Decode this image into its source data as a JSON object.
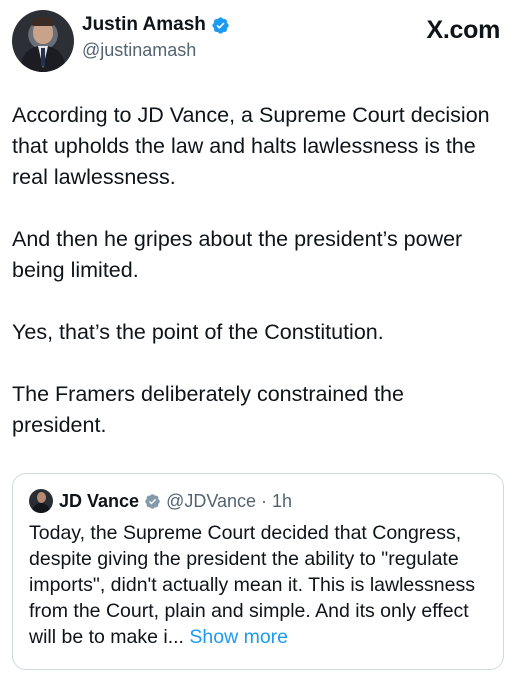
{
  "author": {
    "name": "Justin Amash",
    "handle": "@justinamash"
  },
  "brand": "X.com",
  "post": {
    "paragraphs": [
      "According to JD Vance, a Supreme Court decision that upholds the law and halts lawlessness is the real lawlessness.",
      "And then he gripes about the president’s power being limited.",
      "Yes, that’s the point of the Constitution.",
      "The Framers deliberately constrained the president."
    ]
  },
  "quoted": {
    "name": "JD Vance",
    "handle_time": "@JDVance · 1h",
    "text": "Today, the Supreme Court decided that Congress, despite giving the president the ability to \"regulate imports\", didn't actually mean it. This is lawlessness from the Court, plain and simple. And its only effect will be to make i...",
    "show_more": " Show more"
  },
  "colors": {
    "verified_blue": "#1d9bf0",
    "verified_gray": "#829aab",
    "text": "#0f1419",
    "secondary": "#536471"
  }
}
